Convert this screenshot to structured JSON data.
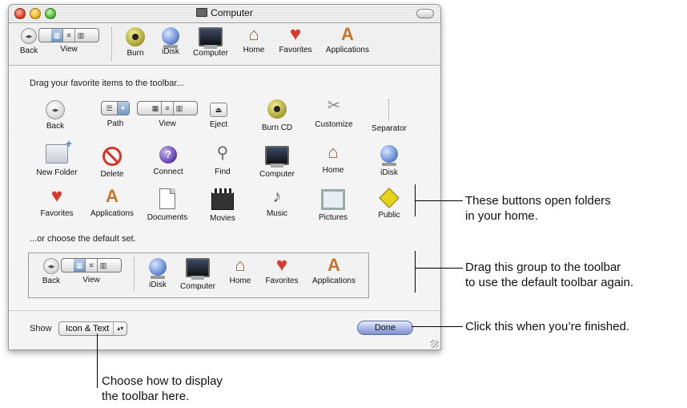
{
  "window": {
    "title": "Computer"
  },
  "toolbar": {
    "items": [
      {
        "label": "Back"
      },
      {
        "label": "View"
      },
      {
        "label": "Burn"
      },
      {
        "label": "iDisk"
      },
      {
        "label": "Computer"
      },
      {
        "label": "Home"
      },
      {
        "label": "Favorites"
      },
      {
        "label": "Applications"
      }
    ]
  },
  "sheet": {
    "prompt": "Drag your favorite items to the toolbar...",
    "items": [
      {
        "label": "Back",
        "icon": "back-icon"
      },
      {
        "label": "Path",
        "icon": "path-icon"
      },
      {
        "label": "View",
        "icon": "view-icon"
      },
      {
        "label": "Eject",
        "icon": "eject-icon"
      },
      {
        "label": "Burn CD",
        "icon": "burn-icon"
      },
      {
        "label": "Customize",
        "icon": "customize-icon"
      },
      {
        "label": "Separator",
        "icon": "separator-icon"
      },
      {
        "label": "New Folder",
        "icon": "new-folder-icon"
      },
      {
        "label": "Delete",
        "icon": "delete-icon"
      },
      {
        "label": "Connect",
        "icon": "connect-icon"
      },
      {
        "label": "Find",
        "icon": "find-icon"
      },
      {
        "label": "Computer",
        "icon": "computer-icon"
      },
      {
        "label": "Home",
        "icon": "home-icon"
      },
      {
        "label": "iDisk",
        "icon": "idisk-icon"
      },
      {
        "label": "Favorites",
        "icon": "favorites-icon"
      },
      {
        "label": "Applications",
        "icon": "applications-icon"
      },
      {
        "label": "Documents",
        "icon": "documents-icon"
      },
      {
        "label": "Movies",
        "icon": "movies-icon"
      },
      {
        "label": "Music",
        "icon": "music-icon"
      },
      {
        "label": "Pictures",
        "icon": "pictures-icon"
      },
      {
        "label": "Public",
        "icon": "public-icon"
      }
    ],
    "default_prompt": "...or choose the default set.",
    "default_items": [
      {
        "label": "Back"
      },
      {
        "label": "View"
      },
      {
        "label": "iDisk"
      },
      {
        "label": "Computer"
      },
      {
        "label": "Home"
      },
      {
        "label": "Favorites"
      },
      {
        "label": "Applications"
      }
    ],
    "show_label": "Show",
    "show_value": "Icon & Text",
    "done_label": "Done"
  },
  "annotations": {
    "home_folders": [
      "These buttons open folders",
      "in your home."
    ],
    "default_set": [
      "Drag this group to the toolbar",
      "to use the default toolbar again."
    ],
    "done": "Click this when you’re finished.",
    "show": [
      "Choose how to display",
      "the toolbar here."
    ]
  },
  "colors": {
    "done_button": "#a9b7e6",
    "favorites_heart": "#d93a2c"
  }
}
